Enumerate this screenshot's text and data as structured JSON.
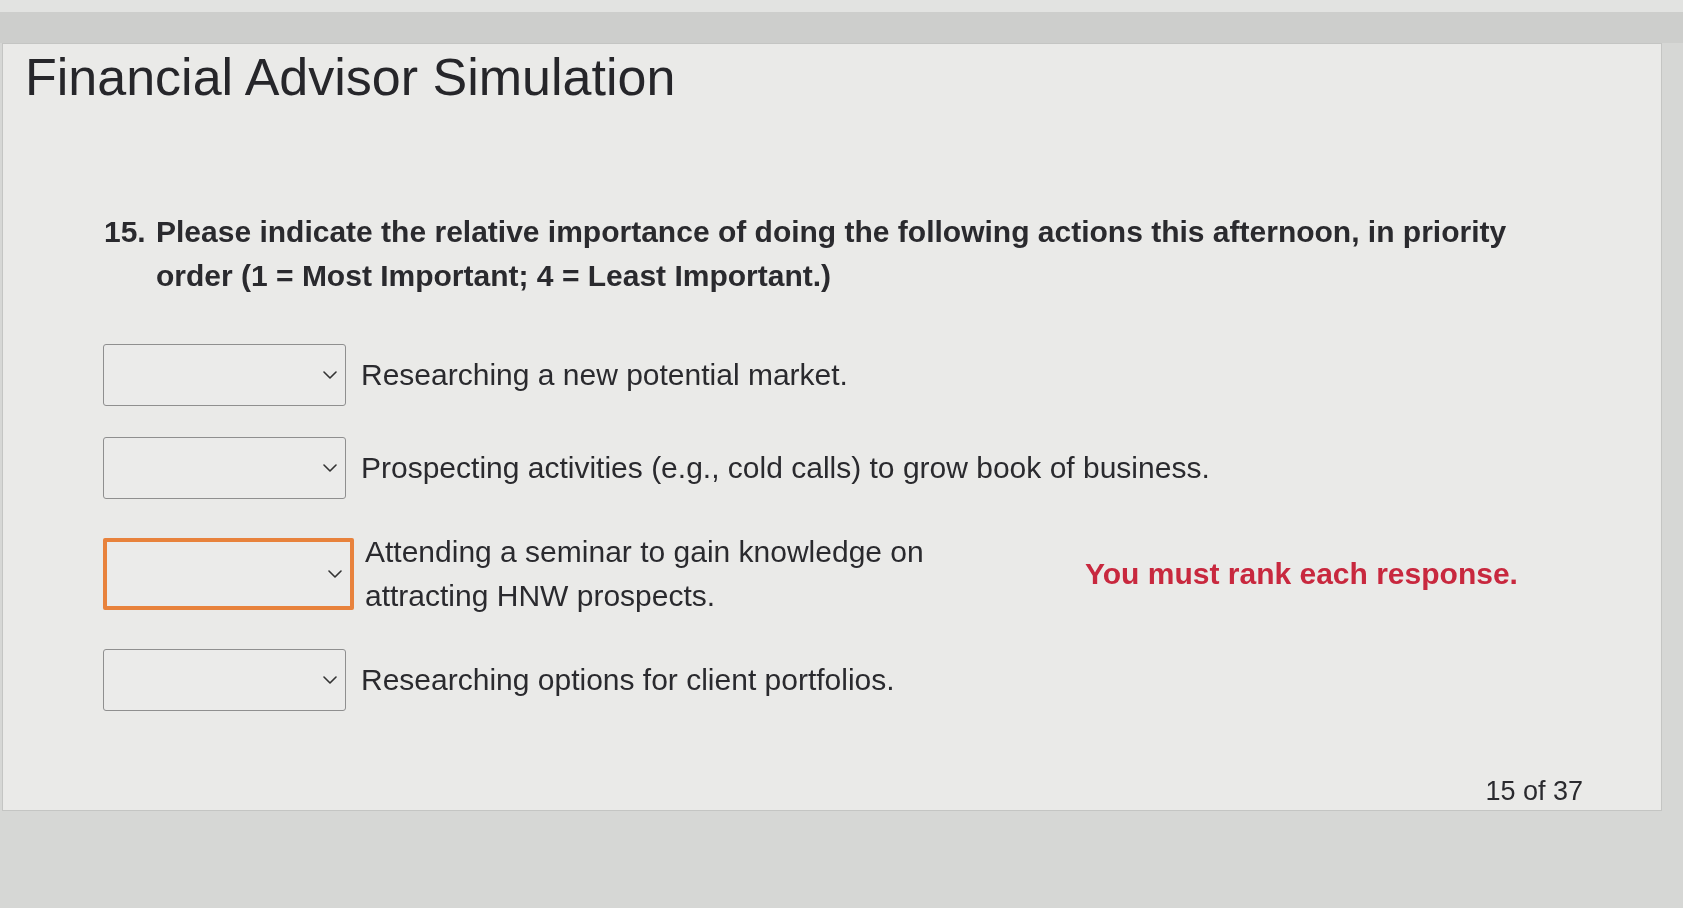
{
  "title": "Financial Advisor Simulation",
  "question": {
    "number": "15.",
    "text": "Please indicate the relative importance of doing the following actions this afternoon, in priority order (1 = Most Important; 4 = Least Important.)"
  },
  "items": [
    {
      "label": "Researching a new potential market.",
      "invalid": false
    },
    {
      "label": "Prospecting activities (e.g., cold calls) to grow book of business.",
      "invalid": false
    },
    {
      "label": "Attending a seminar to gain knowledge on attracting HNW prospects.",
      "invalid": true,
      "message": "You must rank each response."
    },
    {
      "label": "Researching options for client portfolios.",
      "invalid": false
    }
  ],
  "progress": "15 of 37"
}
